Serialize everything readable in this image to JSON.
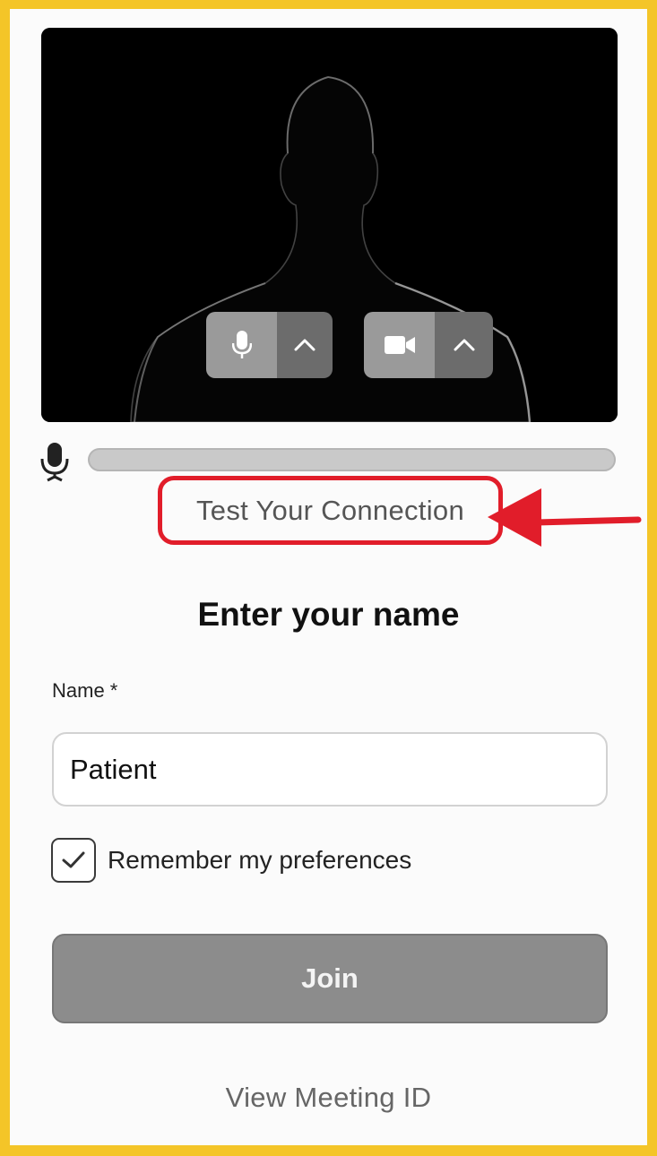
{
  "preview": {
    "mic_button_icon": "microphone-icon",
    "mic_options_icon": "chevron-up-icon",
    "camera_button_icon": "video-camera-icon",
    "camera_options_icon": "chevron-up-icon"
  },
  "audio_level": {
    "icon": "microphone-icon",
    "level": 0
  },
  "test_connection": {
    "label": "Test Your Connection",
    "highlight_color": "#e11d2a"
  },
  "form": {
    "heading": "Enter your name",
    "name_label": "Name *",
    "name_value": "Patient",
    "remember_label": "Remember my preferences",
    "remember_checked": true
  },
  "join_label": "Join",
  "view_meeting_id_label": "View Meeting ID",
  "colors": {
    "border": "#f4c528",
    "highlight": "#e11d2a",
    "button": "#8c8c8c"
  }
}
